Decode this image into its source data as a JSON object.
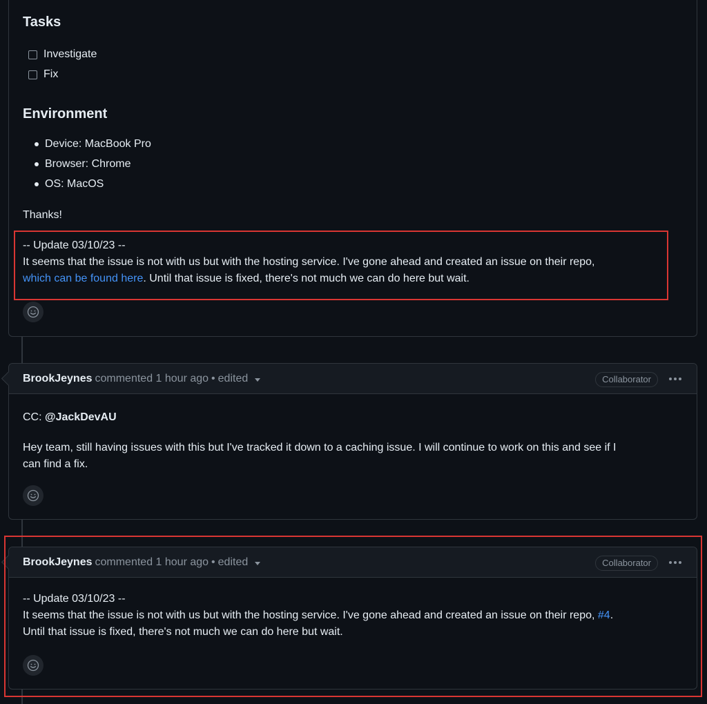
{
  "top_comment": {
    "tasks_heading": "Tasks",
    "tasks": [
      "Investigate",
      "Fix"
    ],
    "environment_heading": "Environment",
    "environment_items": [
      "Device: MacBook Pro",
      "Browser: Chrome",
      "OS: MacOS"
    ],
    "thanks": "Thanks!",
    "update_header": "-- Update 03/10/23 --",
    "update_line1": "It seems that the issue is not with us but with the hosting service. I've gone ahead and created an issue on their repo,",
    "update_link": "which can be found here",
    "update_line2_rest": ". Until that issue is fixed, there's not much we can do here but wait.",
    "emoji_icon": "smiley-icon"
  },
  "comment2": {
    "author": "BrookJeynes",
    "meta": "commented 1 hour ago",
    "separator": "•",
    "edited": "edited",
    "badge": "Collaborator",
    "cc_label": "CC: ",
    "cc_mention": "@JackDevAU",
    "body_line1": "Hey team, still having issues with this but I've tracked it down to a caching issue. I will continue to work on this and see if I",
    "body_line2": "can find a fix."
  },
  "comment3": {
    "author": "BrookJeynes",
    "meta": "commented 1 hour ago",
    "separator": "•",
    "edited": "edited",
    "badge": "Collaborator",
    "update_header": "-- Update 03/10/23 --",
    "line1": "It seems that the issue is not with us but with the hosting service. I've gone ahead and created an issue on their repo,",
    "issue_link": "#4",
    "line1_end": ".",
    "line2": "Until that issue is fixed, there's not much we can do here but wait."
  },
  "colors": {
    "background": "#0d1117",
    "link": "#4493f8",
    "highlight_border": "#da3633"
  }
}
